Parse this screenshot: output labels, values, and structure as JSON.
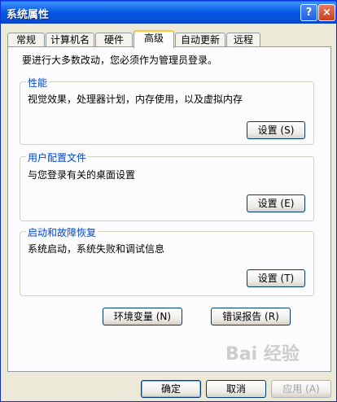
{
  "window": {
    "title": "系统属性",
    "help_glyph": "?",
    "close_glyph": "×"
  },
  "tabs": [
    {
      "label": "常规"
    },
    {
      "label": "计算机名"
    },
    {
      "label": "硬件"
    },
    {
      "label": "高级",
      "active": true
    },
    {
      "label": "自动更新"
    },
    {
      "label": "远程"
    }
  ],
  "panel": {
    "intro": "要进行大多数改动，您必须作为管理员登录。",
    "groups": {
      "performance": {
        "title": "性能",
        "description": "视觉效果，处理器计划，内存使用，以及虚拟内存",
        "button": "设置 (S)"
      },
      "user_profiles": {
        "title": "用户配置文件",
        "description": "与您登录有关的桌面设置",
        "button": "设置 (E)"
      },
      "startup_recovery": {
        "title": "启动和故障恢复",
        "description": "系统启动，系统失败和调试信息",
        "button": "设置 (T)"
      }
    },
    "env_button": "环境变量 (N)",
    "error_button": "错误报告 (R)"
  },
  "footer": {
    "ok": "确定",
    "cancel": "取消",
    "apply": "应用 (A)"
  },
  "watermark": "Bai 经验"
}
